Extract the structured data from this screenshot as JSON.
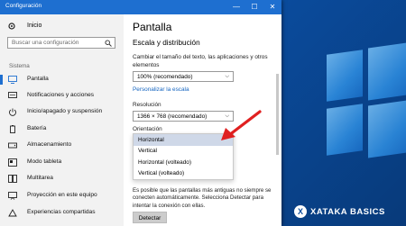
{
  "window": {
    "title": "Configuración",
    "controls": [
      "—",
      "☐",
      "✕"
    ]
  },
  "sidebar": {
    "home": "Inicio",
    "search_placeholder": "Buscar una configuración",
    "section": "Sistema",
    "items": [
      {
        "label": "Pantalla",
        "icon": "display-icon",
        "active": true
      },
      {
        "label": "Notificaciones y acciones",
        "icon": "notifications-icon"
      },
      {
        "label": "Inicio/apagado y suspensión",
        "icon": "power-icon"
      },
      {
        "label": "Batería",
        "icon": "battery-icon"
      },
      {
        "label": "Almacenamiento",
        "icon": "storage-icon"
      },
      {
        "label": "Modo tableta",
        "icon": "tablet-mode-icon"
      },
      {
        "label": "Multitarea",
        "icon": "multitasking-icon"
      },
      {
        "label": "Proyección en este equipo",
        "icon": "projection-icon"
      },
      {
        "label": "Experiencias compartidas",
        "icon": "shared-experiences-icon"
      }
    ]
  },
  "main": {
    "title": "Pantalla",
    "section_title": "Escala y distribución",
    "scale_desc": "Cambiar el tamaño del texto, las aplicaciones y otros elementos",
    "scale_value": "100% (recomendado)",
    "custom_scale_link": "Personalizar la escala",
    "resolution_label": "Resolución",
    "resolution_value": "1366 × 768 (recomendado)",
    "orientation_label": "Orientación",
    "orientation_options": [
      {
        "label": "Horizontal",
        "selected": true
      },
      {
        "label": "Vertical"
      },
      {
        "label": "Horizontal (volteado)"
      },
      {
        "label": "Vertical (volteado)"
      }
    ],
    "detect_note": "Es posible que las pantallas más antiguas no siempre se conecten automáticamente. Selecciona Detectar para intentar la conexión con ellas.",
    "detect_button": "Detectar"
  },
  "watermark": {
    "badge": "X",
    "text": "XATAKA BASICS"
  },
  "colors": {
    "accent": "#1e6fd0",
    "arrow": "#e02020",
    "desktop": "#0a4b9c"
  }
}
